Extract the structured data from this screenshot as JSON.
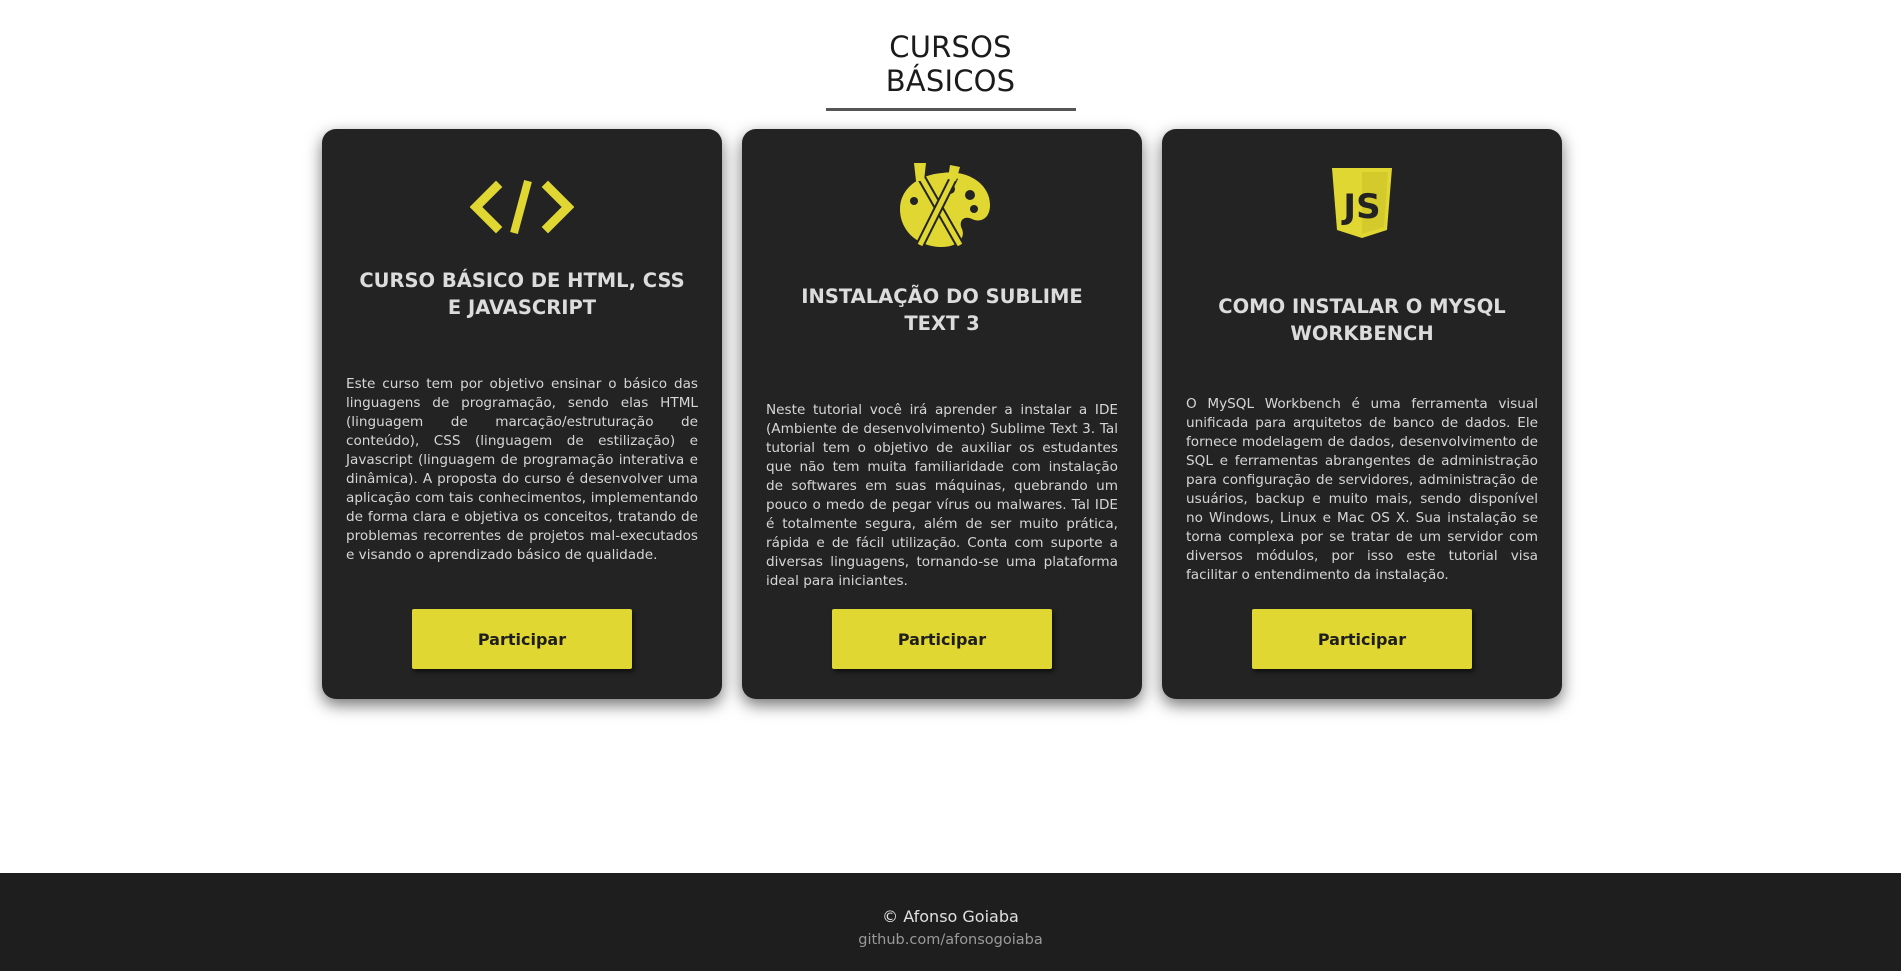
{
  "section": {
    "title": "CURSOS BÁSICOS"
  },
  "colors": {
    "accent": "#e1d732",
    "card_bg": "#232323",
    "footer_bg": "#1e1e1e"
  },
  "cards": [
    {
      "icon": "code-icon",
      "title": "CURSO BÁSICO DE HTML, CSS E JAVASCRIPT",
      "description": "Este curso tem por objetivo ensinar o básico das linguagens de programação, sendo elas HTML (linguagem de marcação/estruturação de conteúdo), CSS (linguagem de estilização) e Javascript (linguagem de programação interativa e dinâmica). A proposta do curso é desenvolver uma aplicação com tais conhecimentos, implementando de forma clara e objetiva os conceitos, tratando de problemas recorrentes de projetos mal-executados e visando o aprendizado básico de qualidade.",
      "button": "Participar"
    },
    {
      "icon": "palette-brush-icon",
      "title": "INSTALAÇÃO DO SUBLIME TEXT 3",
      "description": "Neste tutorial você irá aprender a instalar a IDE (Ambiente de desenvolvimento) Sublime Text 3. Tal tutorial tem o objetivo de auxiliar os estudantes que não tem muita familiaridade com instalação de softwares em suas máquinas, quebrando um pouco o medo de pegar vírus ou malwares. Tal IDE é totalmente segura, além de ser muito prática, rápida e de fácil utilização. Conta com suporte a diversas linguagens, tornando-se uma plataforma ideal para iniciantes.",
      "button": "Participar"
    },
    {
      "icon": "javascript-shield-icon",
      "icon_text": "JS",
      "title": "COMO INSTALAR O MYSQL WORKBENCH",
      "description": "O MySQL Workbench é uma ferramenta visual unificada para arquitetos de banco de dados. Ele fornece modelagem de dados, desenvolvimento de SQL e ferramentas abrangentes de administração para configuração de servidores, administração de usuários, backup e muito mais, sendo disponível no Windows, Linux e Mac OS X. Sua instalação se torna complexa por se tratar de um servidor com diversos módulos, por isso este tutorial visa facilitar o entendimento da instalação.",
      "button": "Participar"
    }
  ],
  "footer": {
    "copyright": "© Afonso Goiaba",
    "link": "github.com/afonsogoiaba"
  }
}
